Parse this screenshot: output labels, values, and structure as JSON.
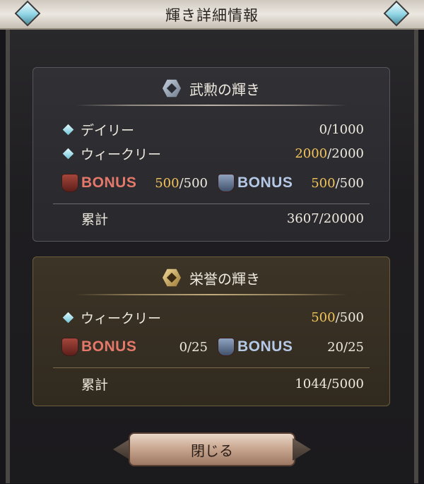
{
  "dialog": {
    "title": "輝き詳細情報",
    "close_label": "閉じる"
  },
  "merit": {
    "heading": "武勲の輝き",
    "daily_label": "デイリー",
    "daily_value": "0/1000",
    "weekly_label": "ウィークリー",
    "weekly_current": "2000",
    "weekly_max": "/2000",
    "bonus_r_label": "BONUS",
    "bonus_r_current": "500",
    "bonus_r_max": "/500",
    "bonus_s_label": "BONUS",
    "bonus_s_current": "500",
    "bonus_s_max": "/500",
    "total_label": "累計",
    "total_value": "3607/20000"
  },
  "honor": {
    "heading": "栄誉の輝き",
    "weekly_label": "ウィークリー",
    "weekly_current": "500",
    "weekly_max": "/500",
    "bonus_r_label": "BONUS",
    "bonus_r_value": "0/25",
    "bonus_s_label": "BONUS",
    "bonus_s_value": "20/25",
    "total_label": "累計",
    "total_value": "1044/5000"
  },
  "colors": {
    "highlight": "#f2c45a",
    "bonus_red": "#e4786a",
    "bonus_blue": "#b5c8e6"
  },
  "icons": [
    "diamond-bullet-icon",
    "merit-hexagon-icon",
    "honor-hexagon-icon",
    "red-shield-badge-icon",
    "silver-shield-badge-icon",
    "corner-gem-icon"
  ]
}
